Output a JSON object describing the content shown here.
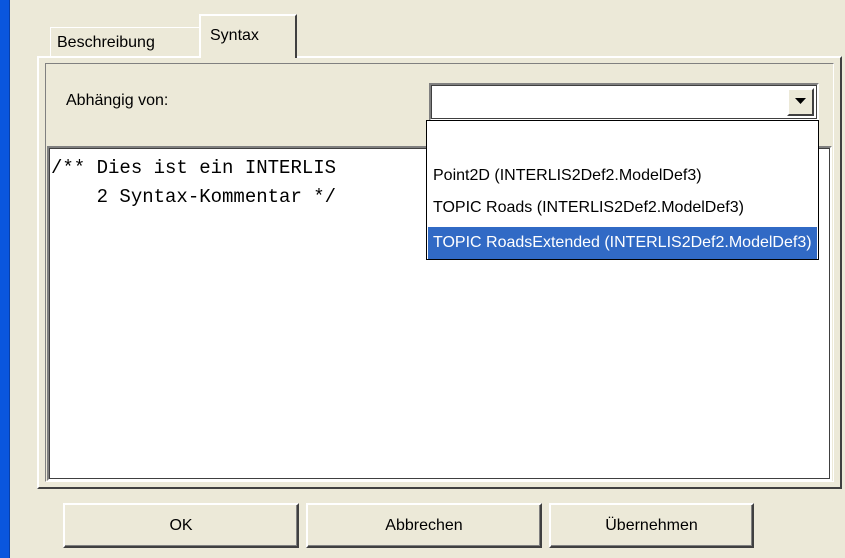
{
  "tabs": {
    "description": "Beschreibung",
    "syntax": "Syntax"
  },
  "syntax_panel": {
    "depends_label": "Abhängig von:",
    "combo_value": "",
    "editor_lines": [
      "/** Dies ist ein INTERLIS",
      "    2 Syntax-Kommentar */"
    ],
    "dropdown_options": [
      "",
      "Point2D (INTERLIS2Def2.ModelDef3)",
      "TOPIC Roads (INTERLIS2Def2.ModelDef3)",
      "TOPIC RoadsExtended (INTERLIS2Def2.ModelDef3)"
    ],
    "selected_index": 3
  },
  "buttons": {
    "ok": "OK",
    "cancel": "Abbrechen",
    "apply": "Übernehmen"
  },
  "colors": {
    "window_bg": "#ECE9D8",
    "selection": "#316AC5",
    "frame_blue": "#0A56DE"
  },
  "icons": {
    "combo_arrow": "chevron-down-icon"
  }
}
